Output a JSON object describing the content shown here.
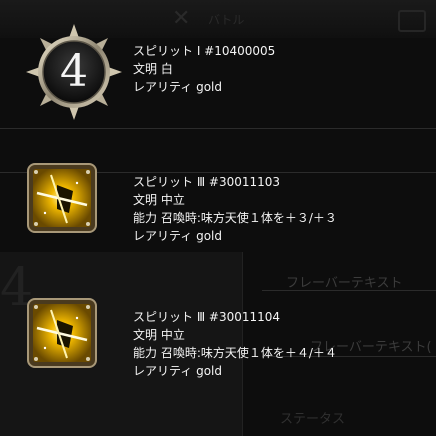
{
  "background": {
    "battle_label": "バトル",
    "flavor_text_label": "フレーバーテキスト",
    "flavor_text_label_2": "フレーバーテキスト(",
    "status_label": "ステータス"
  },
  "entries": [
    {
      "icon": "spirit-number-4-badge-icon",
      "name": "スピリット Ⅰ #10400005",
      "civilization": "文明 白",
      "rarity": "レアリティ gold"
    },
    {
      "icon": "golden-angel-spirit-icon",
      "name": "スピリット Ⅲ #30011103",
      "civilization": "文明 中立",
      "ability": "能力 召喚時:味方天使１体を＋３/＋３",
      "rarity": "レアリティ gold"
    },
    {
      "icon": "golden-angel-spirit-icon",
      "name": "スピリット Ⅲ #30011104",
      "civilization": "文明 中立",
      "ability": "能力 召喚時:味方天使１体を＋４/＋４",
      "rarity": "レアリティ gold"
    }
  ],
  "badge_number": "4",
  "colors": {
    "gold": "#e8b000",
    "background": "#0d0d0d",
    "text": "#f4f4f4"
  }
}
